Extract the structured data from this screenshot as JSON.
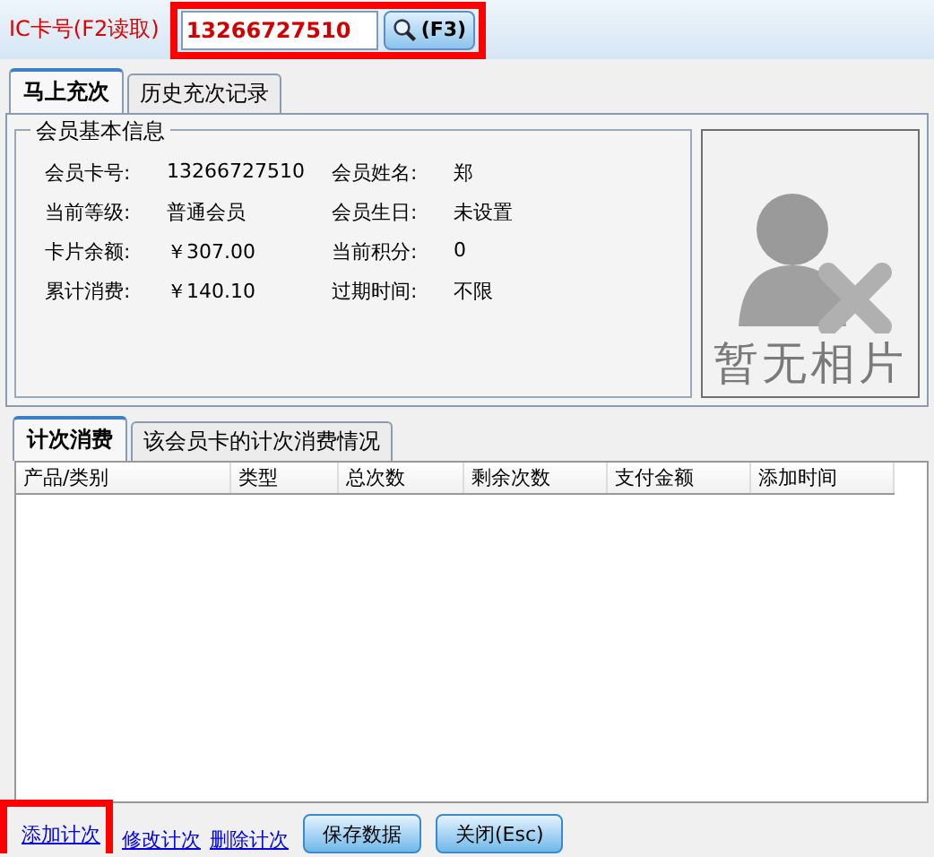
{
  "card_bar": {
    "label": "IC卡号(F2读取)",
    "card_number": "13266727510",
    "search_button": "(F3)"
  },
  "tabs": [
    {
      "label": "马上充次",
      "selected": true
    },
    {
      "label": "历史充次记录",
      "selected": false
    }
  ],
  "member_info": {
    "title": "会员基本信息",
    "fields": [
      {
        "label": "会员卡号:",
        "value": "13266727510"
      },
      {
        "label": "会员姓名:",
        "value": "郑"
      },
      {
        "label": "当前等级:",
        "value": "普通会员"
      },
      {
        "label": "会员生日:",
        "value": "未设置"
      },
      {
        "label": "卡片余额:",
        "value": "￥307.00"
      },
      {
        "label": "当前积分:",
        "value": "0"
      },
      {
        "label": "累计消费:",
        "value": "￥140.10"
      },
      {
        "label": "过期时间:",
        "value": "不限"
      }
    ]
  },
  "photo": {
    "caption": "暂无相片"
  },
  "sub_tabs": [
    {
      "label": "计次消费",
      "selected": true
    },
    {
      "label": "该会员卡的计次消费情况",
      "selected": false
    }
  ],
  "table": {
    "columns": [
      "产品/类别",
      "类型",
      "总次数",
      "剩余次数",
      "支付金额",
      "添加时间"
    ]
  },
  "links": [
    "添加计次",
    "修改计次",
    "删除计次"
  ],
  "buttons": [
    "保存数据",
    "关闭(Esc)"
  ]
}
